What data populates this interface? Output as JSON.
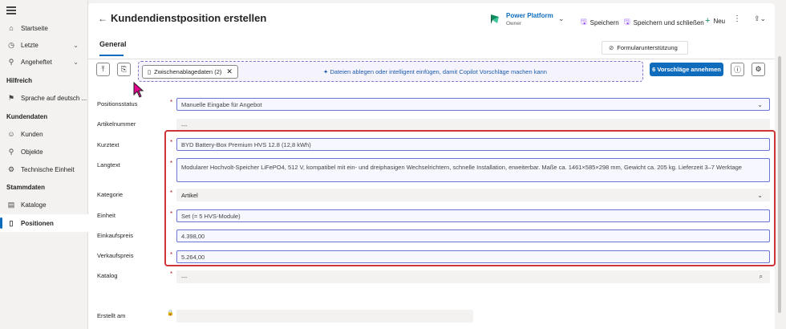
{
  "sidebar": {
    "items": [
      {
        "label": "Startseite",
        "icon": "home-icon"
      },
      {
        "label": "Letzte",
        "icon": "clock-icon"
      },
      {
        "label": "Angeheftet",
        "icon": "pin-icon"
      }
    ],
    "sections": [
      {
        "title": "Hilfreich",
        "items": [
          {
            "label": "Sprache auf deutsch ...",
            "icon": "flag-icon"
          }
        ]
      },
      {
        "title": "Kundendaten",
        "items": [
          {
            "label": "Kunden",
            "icon": "person-icon"
          },
          {
            "label": "Objekte",
            "icon": "pin-icon"
          },
          {
            "label": "Technische Einheit",
            "icon": "gear-icon"
          }
        ]
      },
      {
        "title": "Stammdaten",
        "items": [
          {
            "label": "Kataloge",
            "icon": "catalog-icon"
          },
          {
            "label": "Positionen",
            "icon": "document-icon"
          }
        ]
      }
    ]
  },
  "header": {
    "title": "Kundendienstposition erstellen",
    "tab": "General",
    "app_name": "Power Platform",
    "owner": "Owner",
    "commands": {
      "save": "Speichern",
      "save_close": "Speichern und schließen",
      "new": "Neu"
    },
    "form_assist": "Formularunterstützung"
  },
  "toolbar": {
    "clipboard_chip": "Zwischenablagedaten (2)",
    "dropzone_text": "Dateien ablegen oder intelligent einfügen, damit Copilot Vorschläge machen kann",
    "accept_button": "6 Vorschläge annehmen"
  },
  "form": {
    "positionsstatus": {
      "label": "Positionsstatus",
      "value": "Manuelle Eingabe für Angebot"
    },
    "artikelnummer": {
      "label": "Artikelnummer",
      "value": "---"
    },
    "kurztext": {
      "label": "Kurztext",
      "value": "BYD Battery-Box Premium HVS 12.8 (12,8 kWh)"
    },
    "langtext": {
      "label": "Langtext",
      "value": "Modularer Hochvolt-Speicher LiFePO4, 512 V, kompatibel mit ein- und dreiphasigen Wechselrichtern, schnelle Installation, erweiterbar. Maße ca. 1461×585×298 mm, Gewicht ca. 205 kg. Lieferzeit 3–7 Werktage"
    },
    "kategorie": {
      "label": "Kategorie",
      "value": "Artikel"
    },
    "einheit": {
      "label": "Einheit",
      "value": "Set (= 5 HVS-Module)"
    },
    "einkaufspreis": {
      "label": "Einkaufspreis",
      "value": "4.398,00"
    },
    "verkaufspreis": {
      "label": "Verkaufspreis",
      "value": "5.264,00"
    },
    "katalog": {
      "label": "Katalog",
      "value": "---"
    },
    "erstellt_am": {
      "label": "Erstellt am",
      "value": ""
    }
  },
  "colors": {
    "accent": "#0f6cbd",
    "highlight": "#d13438",
    "copilot": "#6c74d8"
  }
}
